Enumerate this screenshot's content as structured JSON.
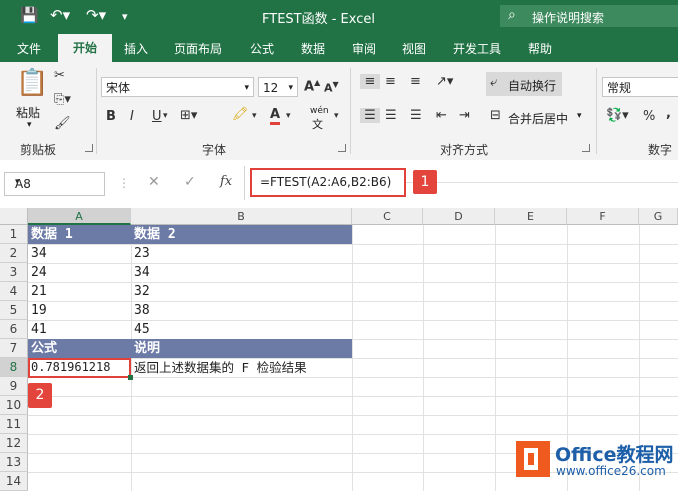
{
  "window": {
    "title": "FTEST函数 - Excel",
    "search_placeholder": "操作说明搜索"
  },
  "tabs": [
    "文件",
    "开始",
    "插入",
    "页面布局",
    "公式",
    "数据",
    "审阅",
    "视图",
    "开发工具",
    "帮助"
  ],
  "ribbon": {
    "paste_label": "粘贴",
    "clipboard_label": "剪贴板",
    "font_name": "宋体",
    "font_size": "12",
    "font_label": "字体",
    "bold": "B",
    "italic": "I",
    "underline": "U",
    "font_color_glyph": "A",
    "phonetic": "wén",
    "wrap_text": "自动换行",
    "merge_center": "合并后居中",
    "alignment_label": "对齐方式",
    "number_format": "常规",
    "number_label": "数字",
    "percent": "%",
    "comma": ","
  },
  "formula_bar": {
    "name_box": "A8",
    "fx": "fx",
    "formula": "=FTEST(A2:A6,B2:B6)",
    "tag1": "1",
    "tag2": "2"
  },
  "columns": [
    "A",
    "B",
    "C",
    "D",
    "E",
    "F",
    "G"
  ],
  "rows": [
    "1",
    "2",
    "3",
    "4",
    "5",
    "6",
    "7",
    "8",
    "9",
    "10",
    "11",
    "12",
    "13",
    "14"
  ],
  "cells": {
    "r1": [
      "数据 1",
      "数据 2"
    ],
    "r2": [
      "34",
      "23"
    ],
    "r3": [
      "24",
      "34"
    ],
    "r4": [
      "21",
      "32"
    ],
    "r5": [
      "19",
      "38"
    ],
    "r6": [
      "41",
      "45"
    ],
    "r7": [
      "公式",
      "说明"
    ],
    "r8": [
      "0.781961218",
      "返回上述数据集的 F 检验结果"
    ]
  },
  "watermark": {
    "brand": "Office教程网",
    "url": "www.office26.com"
  },
  "colors": {
    "excel_green": "#217346",
    "header_fill": "#6c7aa6",
    "highlight_red": "#e0413a"
  }
}
